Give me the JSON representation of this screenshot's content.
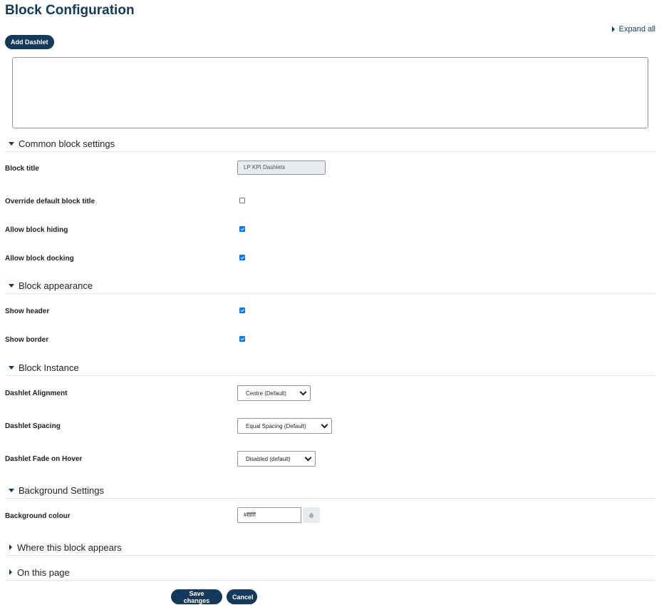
{
  "page_title": "Block Configuration",
  "expand_all": "Expand all",
  "add_dashlet": "Add Dashlet",
  "sections": {
    "common": "Common block settings",
    "appearance": "Block appearance",
    "instance": "Block Instance",
    "background": "Background Settings",
    "where": "Where this block appears",
    "on_page": "On this page"
  },
  "fields": {
    "block_title": {
      "label": "Block title",
      "value": "LP KPI Dashlets"
    },
    "override_title": {
      "label": "Override default block title",
      "checked": false
    },
    "allow_hiding": {
      "label": "Allow block hiding",
      "checked": true
    },
    "allow_docking": {
      "label": "Allow block docking",
      "checked": true
    },
    "show_header": {
      "label": "Show header",
      "checked": true
    },
    "show_border": {
      "label": "Show border",
      "checked": true
    },
    "dashlet_alignment": {
      "label": "Dashlet Alignment",
      "value": "Centre (Default)"
    },
    "dashlet_spacing": {
      "label": "Dashlet Spacing",
      "value": "Equal Spacing (Default)"
    },
    "dashlet_fade": {
      "label": "Dashlet Fade on Hover",
      "value": "Disabled (default)"
    },
    "background_colour": {
      "label": "Background colour",
      "value": "#ffffff"
    }
  },
  "buttons": {
    "save": "Save changes",
    "cancel": "Cancel"
  },
  "colors": {
    "accent": "#15395b",
    "checkbox": "#0075ff"
  },
  "icons": {
    "expand": "caret-right-icon",
    "collapse": "caret-down-icon",
    "picker": "color-drop-icon",
    "select": "chevron-down-icon"
  }
}
